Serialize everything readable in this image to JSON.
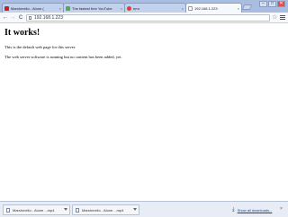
{
  "tabs": [
    {
      "label": "Marshmello - Alone (",
      "favicon_color": "#cc2020",
      "active": false
    },
    {
      "label": "The fastest free YouTube",
      "favicon_color": "#4caf50",
      "active": false
    },
    {
      "label": "erro",
      "favicon_color": "#e53935",
      "active": false
    },
    {
      "label": "192.168.1.223",
      "favicon_color": "#ffffff",
      "active": true
    }
  ],
  "tab_close_glyph": "×",
  "window_controls": {
    "minimize": "–",
    "maximize": "□",
    "close": "✕"
  },
  "toolbar": {
    "back_glyph": "←",
    "forward_glyph": "→",
    "reload_glyph": "C",
    "url": "192.168.1.223",
    "star_glyph": "☆"
  },
  "page": {
    "heading": "It works!",
    "line1": "This is the default web page for this server.",
    "line2": "The web server software is running but no content has been added, yet."
  },
  "downloads": {
    "items": [
      {
        "name": "Marshmello - Alone ...mp4"
      },
      {
        "name": "Marshmello - Alone ...mp4"
      }
    ],
    "download_glyph": "⤓",
    "show_all": "Show all downloads...",
    "close_glyph": "×"
  }
}
